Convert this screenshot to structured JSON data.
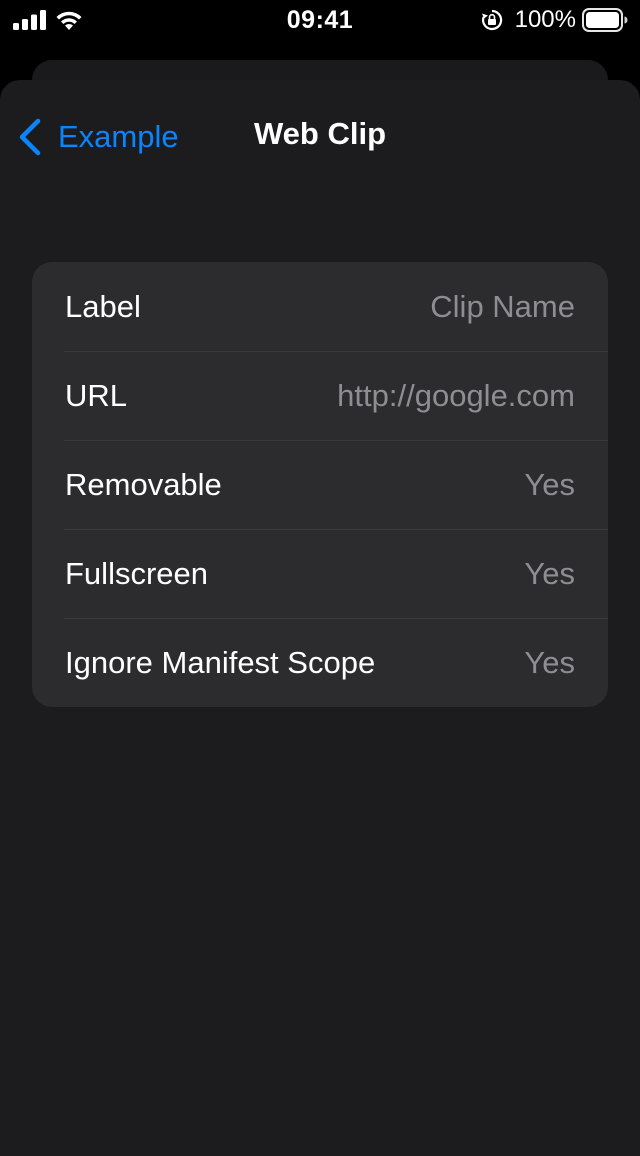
{
  "status_bar": {
    "time": "09:41",
    "battery_percent": "100%",
    "icons": [
      "signal-icon",
      "wifi-icon",
      "orientation-lock-icon",
      "battery-icon"
    ]
  },
  "nav": {
    "back_label": "Example",
    "title": "Web Clip"
  },
  "rows": [
    {
      "label": "Label",
      "value": "Clip Name"
    },
    {
      "label": "URL",
      "value": "http://google.com"
    },
    {
      "label": "Removable",
      "value": "Yes"
    },
    {
      "label": "Fullscreen",
      "value": "Yes"
    },
    {
      "label": "Ignore Manifest Scope",
      "value": "Yes"
    }
  ],
  "colors": {
    "accent": "#0a84ff",
    "background": "#000000",
    "sheet": "#1c1c1e",
    "cell": "#2c2c2e",
    "secondary_text": "#8d8d93"
  }
}
